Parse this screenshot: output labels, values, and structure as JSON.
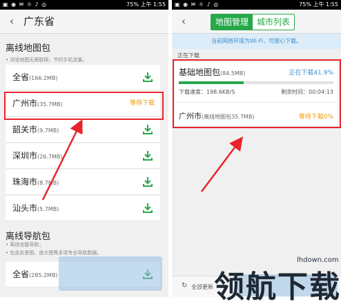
{
  "status_bar": {
    "battery": "75%",
    "time": "上午 1:55"
  },
  "left": {
    "title": "广东省",
    "offline_section": {
      "title": "离线地图包",
      "hint": "• 浏览地图无需联网，节约手机流量。"
    },
    "cities": [
      {
        "name": "全省",
        "size": "(166.2MB)"
      },
      {
        "name": "广州市",
        "size": "(35.7MB)",
        "status": "等待下载"
      },
      {
        "name": "韶关市",
        "size": "(9.7MB)"
      },
      {
        "name": "深圳市",
        "size": "(26.7MB)"
      },
      {
        "name": "珠海市",
        "size": "(8.7MB)"
      },
      {
        "name": "汕头市",
        "size": "(5.7MB)"
      }
    ],
    "nav_section": {
      "title": "离线导航包",
      "hints": [
        "• 离线也能导航；",
        "• 包含实景图、放大图等多项专业导航数据。"
      ]
    },
    "nav_row": {
      "name": "全省",
      "size": "(285.2MB)"
    }
  },
  "right": {
    "tabs": [
      "地图管理",
      "城市列表"
    ],
    "notice": "当前网络环境为Wi-Fi，可放心下载。",
    "downloading_label": "正在下载",
    "item1": {
      "name": "基础地图包",
      "size": "(84.5MB)",
      "status": "正在下载41.9%",
      "progress": 0.419,
      "speed": "下载速度：198.6KB/S",
      "remaining": "剩余时间：00:04:13"
    },
    "item2": {
      "name": "广州市",
      "size": "(离线地图包35.7MB)",
      "status": "等待下载0%"
    },
    "bottom": {
      "update_all": "全部更新"
    }
  },
  "watermark": {
    "site": "lhdown.com",
    "text": "领航下载"
  },
  "colors": {
    "accent": "#27a84a",
    "red": "#e8242b",
    "orange": "#f39800",
    "blue": "#3d8fd1"
  }
}
